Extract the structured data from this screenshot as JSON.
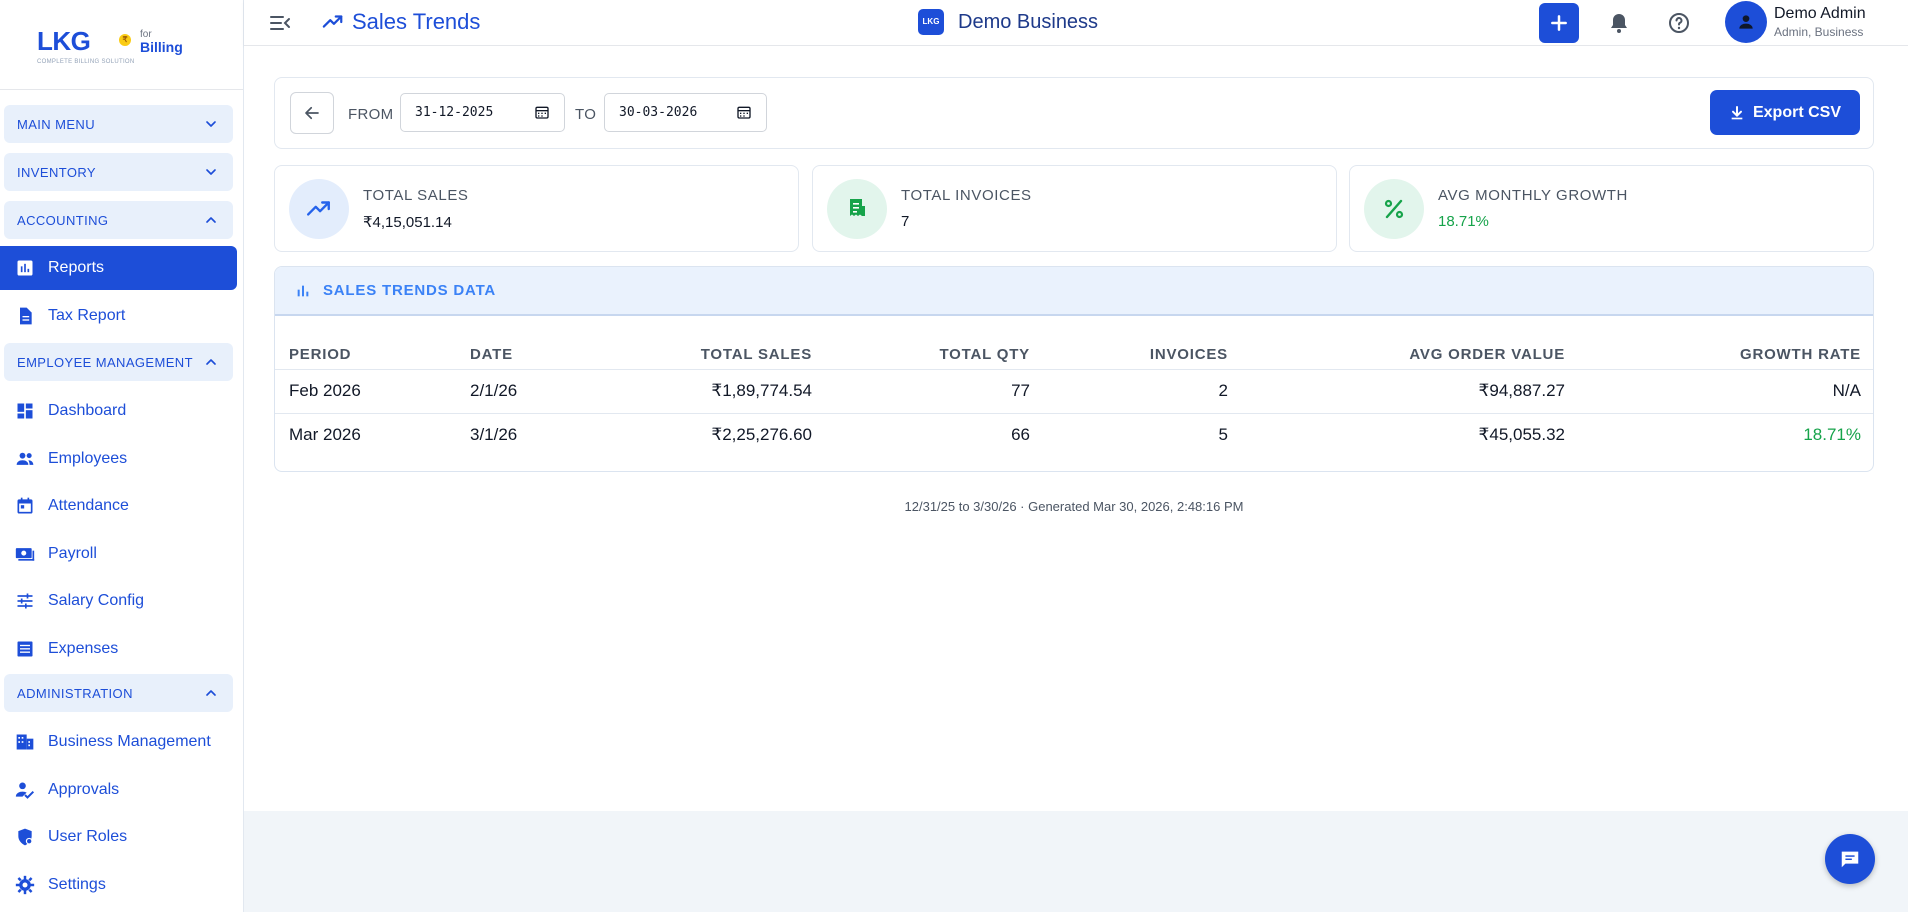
{
  "logo": {
    "main": "LKG",
    "for": "for",
    "billing": "Billing",
    "tagline": "COMPLETE BILLING SOLUTION"
  },
  "sidebar": {
    "sections": [
      {
        "label": "MAIN MENU",
        "expanded": false
      },
      {
        "label": "INVENTORY",
        "expanded": false
      },
      {
        "label": "ACCOUNTING",
        "expanded": true
      },
      {
        "label": "EMPLOYEE MANAGEMENT",
        "expanded": true
      },
      {
        "label": "ADMINISTRATION",
        "expanded": true
      }
    ],
    "items": [
      {
        "label": "Reports",
        "icon": "bar-chart-icon",
        "active": true
      },
      {
        "label": "Tax Report",
        "icon": "document-icon"
      },
      {
        "label": "Dashboard",
        "icon": "dashboard-icon"
      },
      {
        "label": "Employees",
        "icon": "people-icon"
      },
      {
        "label": "Attendance",
        "icon": "calendar-icon"
      },
      {
        "label": "Payroll",
        "icon": "money-icon"
      },
      {
        "label": "Salary Config",
        "icon": "sliders-icon"
      },
      {
        "label": "Expenses",
        "icon": "list-icon"
      },
      {
        "label": "Business Management",
        "icon": "building-icon"
      },
      {
        "label": "Approvals",
        "icon": "person-check-icon"
      },
      {
        "label": "User Roles",
        "icon": "shield-user-icon"
      },
      {
        "label": "Settings",
        "icon": "gear-icon"
      }
    ]
  },
  "header": {
    "title": "Sales Trends",
    "business_logo": "LKG",
    "business_name": "Demo Business",
    "user_name": "Demo Admin",
    "user_role": "Admin, Business"
  },
  "filters": {
    "from_label": "FROM",
    "from_value": "31-12-2025",
    "to_label": "TO",
    "to_value": "30-03-2026",
    "export_label": "Export CSV"
  },
  "stats": [
    {
      "label": "TOTAL SALES",
      "value": "₹4,15,051.14",
      "icon": "trending-up-icon"
    },
    {
      "label": "TOTAL INVOICES",
      "value": "7",
      "icon": "receipt-icon"
    },
    {
      "label": "AVG MONTHLY GROWTH",
      "value": "18.71%",
      "icon": "percent-icon"
    }
  ],
  "table": {
    "title": "SALES TRENDS DATA",
    "columns": [
      "PERIOD",
      "DATE",
      "TOTAL SALES",
      "TOTAL QTY",
      "INVOICES",
      "AVG ORDER VALUE",
      "GROWTH RATE"
    ],
    "rows": [
      [
        "Feb 2026",
        "2/1/26",
        "₹1,89,774.54",
        "77",
        "2",
        "₹94,887.27",
        "N/A"
      ],
      [
        "Mar 2026",
        "3/1/26",
        "₹2,25,276.60",
        "66",
        "5",
        "₹45,055.32",
        "18.71%"
      ]
    ]
  },
  "generated_note": "12/31/25 to 3/30/26 · Generated Mar 30, 2026, 2:48:16 PM",
  "colors": {
    "primary": "#1d4ed8",
    "success": "#16a34a",
    "section_bg": "#e8f0fb"
  }
}
